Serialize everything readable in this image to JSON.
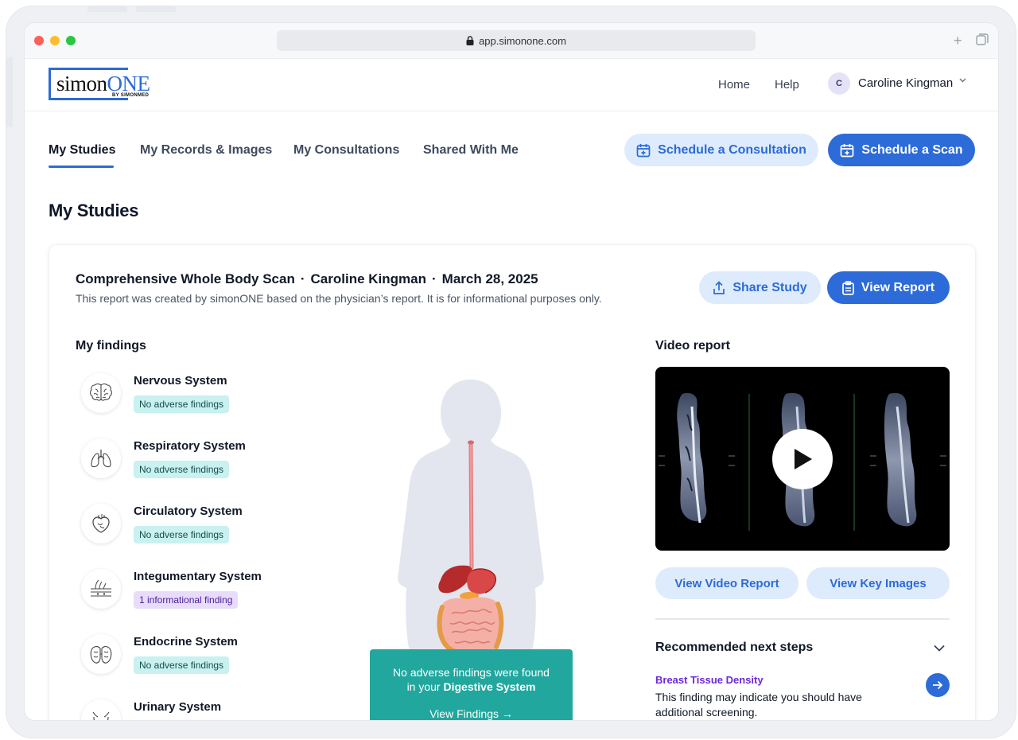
{
  "browser": {
    "url": "app.simonone.com"
  },
  "logo": {
    "word_a": "simon",
    "word_b": "ONE",
    "byline": "BY SIMONMED"
  },
  "nav": {
    "home": "Home",
    "help": "Help"
  },
  "user": {
    "initial": "C",
    "name": "Caroline Kingman"
  },
  "tabs": [
    {
      "label": "My Studies",
      "active": true
    },
    {
      "label": "My Records & Images",
      "active": false
    },
    {
      "label": "My Consultations",
      "active": false
    },
    {
      "label": "Shared With Me",
      "active": false
    }
  ],
  "actions": {
    "consultation": "Schedule a Consultation",
    "scan": "Schedule a Scan"
  },
  "page_title": "My Studies",
  "study": {
    "scan_type": "Comprehensive Whole Body Scan",
    "patient": "Caroline Kingman",
    "date": "March 28, 2025",
    "separator": "·",
    "subtitle": "This report was created by simonONE based on the physician’s report. It is for informational purposes only.",
    "share_label": "Share Study",
    "report_label": "View Report"
  },
  "findings": {
    "title": "My findings",
    "items": [
      {
        "name": "Nervous System",
        "badge": "No adverse findings",
        "status": "ok",
        "icon": "brain-icon"
      },
      {
        "name": "Respiratory System",
        "badge": "No adverse findings",
        "status": "ok",
        "icon": "lungs-icon"
      },
      {
        "name": "Circulatory System",
        "badge": "No adverse findings",
        "status": "ok",
        "icon": "heart-icon"
      },
      {
        "name": "Integumentary System",
        "badge": "1 informational finding",
        "status": "info",
        "icon": "skin-icon"
      },
      {
        "name": "Endocrine System",
        "badge": "No adverse findings",
        "status": "ok",
        "icon": "thyroid-icon"
      },
      {
        "name": "Urinary System",
        "badge": "",
        "status": "ok",
        "icon": "bladder-icon"
      }
    ]
  },
  "digestive_callout": {
    "text_a": "No adverse findings were found in your ",
    "text_b": "Digestive System",
    "link": "View Findings →"
  },
  "video": {
    "title": "Video report",
    "view_video": "View Video Report",
    "view_images": "View Key Images"
  },
  "next_steps": {
    "title": "Recommended next steps",
    "item_title": "Breast Tissue Density",
    "item_desc": "This finding may indicate you should have additional screening."
  },
  "colors": {
    "accent": "#2c6bd8",
    "teal": "#21a79e",
    "ok_badge": "#c8f1f0",
    "info_badge": "#e7ddfb",
    "purple": "#6d28d9"
  }
}
